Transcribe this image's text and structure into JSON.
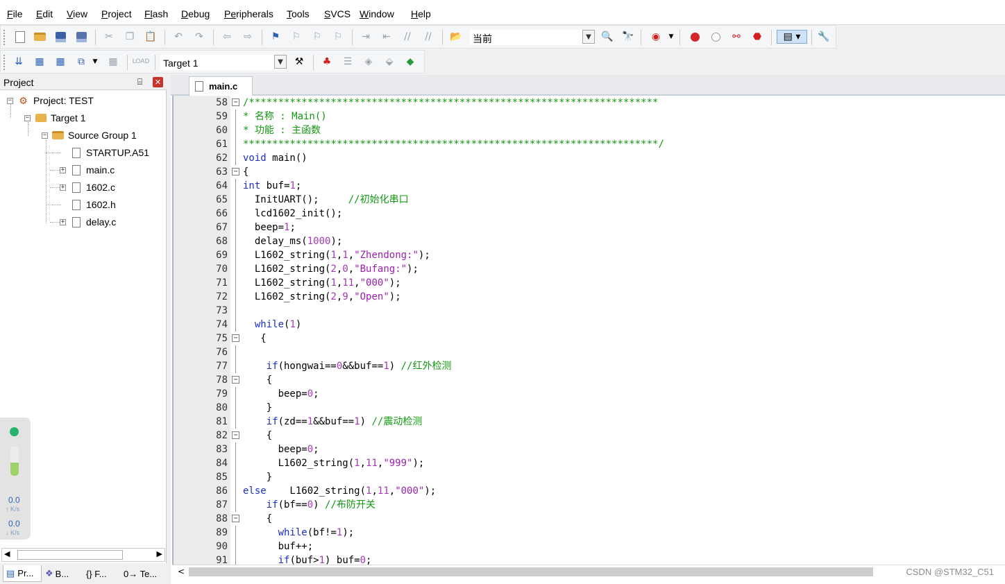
{
  "menubar": {
    "items": [
      {
        "key": "F",
        "rest": "ile"
      },
      {
        "key": "E",
        "rest": "dit"
      },
      {
        "key": "V",
        "rest": "iew"
      },
      {
        "key": "P",
        "rest": "roject"
      },
      {
        "key": "Fl",
        "rest": "ash",
        "pre": ""
      },
      {
        "key": "D",
        "rest": "ebug"
      },
      {
        "key": "Pe",
        "rest": "ripherals"
      },
      {
        "key": "T",
        "rest": "ools"
      },
      {
        "key": "S",
        "rest": "VCS"
      },
      {
        "key": "W",
        "rest": "indow"
      },
      {
        "key": "H",
        "rest": "elp"
      }
    ]
  },
  "toolbar1": {
    "find_combo_value": "当前"
  },
  "toolbar2": {
    "target_combo_value": "Target 1"
  },
  "project_panel": {
    "title": "Project",
    "pin_glyph": "⌸",
    "close_glyph": "✕",
    "tree": {
      "project": "Project: TEST",
      "target": "Target 1",
      "group": "Source Group 1",
      "files": [
        "STARTUP.A51",
        "main.c",
        "1602.c",
        "1602.h",
        "delay.c"
      ]
    },
    "speed": {
      "up_value": "0.0",
      "up_unit": "↑ K/s",
      "down_value": "0.0",
      "down_unit": "↓ K/s"
    },
    "bottom_tabs": [
      "Pr...",
      "B...",
      "{} F...",
      "0→ Te..."
    ]
  },
  "editor": {
    "active_tab": "main.c",
    "watermark": "CSDN @STM32_C51",
    "lines": [
      {
        "n": "58",
        "html": "<span class=\"cm\">/**********************************************************************</span>"
      },
      {
        "n": "59",
        "html": "<span class=\"cm\">* 名称 : Main()</span>"
      },
      {
        "n": "60",
        "html": "<span class=\"cm\">* 功能 : 主函数</span>"
      },
      {
        "n": "61",
        "html": "<span class=\"cm\">***********************************************************************/</span>"
      },
      {
        "n": "62",
        "html": "<span class=\"kw\">void</span> main()"
      },
      {
        "n": "63",
        "html": "{"
      },
      {
        "n": "64",
        "html": "<span class=\"kw\">int</span> buf=<span class=\"nm\">1</span>;"
      },
      {
        "n": "65",
        "html": "  InitUART();     <span class=\"cm\">//初始化串口</span>"
      },
      {
        "n": "66",
        "html": "  lcd1602_init();"
      },
      {
        "n": "67",
        "html": "  beep=<span class=\"nm\">1</span>;"
      },
      {
        "n": "68",
        "html": "  delay_ms(<span class=\"nm\">1000</span>);"
      },
      {
        "n": "69",
        "html": "  L1602_string(<span class=\"nm\">1</span>,<span class=\"nm\">1</span>,<span class=\"st\">\"Zhendong:\"</span>);"
      },
      {
        "n": "70",
        "html": "  L1602_string(<span class=\"nm\">2</span>,<span class=\"nm\">0</span>,<span class=\"st\">\"Bufang:\"</span>);"
      },
      {
        "n": "71",
        "html": "  L1602_string(<span class=\"nm\">1</span>,<span class=\"nm\">11</span>,<span class=\"st\">\"000\"</span>);"
      },
      {
        "n": "72",
        "html": "  L1602_string(<span class=\"nm\">2</span>,<span class=\"nm\">9</span>,<span class=\"st\">\"Open\"</span>);"
      },
      {
        "n": "73",
        "html": ""
      },
      {
        "n": "74",
        "html": "  <span class=\"kw\">while</span>(<span class=\"nm\">1</span>)"
      },
      {
        "n": "75",
        "html": "   {"
      },
      {
        "n": "76",
        "html": ""
      },
      {
        "n": "77",
        "html": "    <span class=\"kw\">if</span>(hongwai==<span class=\"nm\">0</span>&amp;&amp;buf==<span class=\"nm\">1</span>) <span class=\"cm\">//红外检测</span>"
      },
      {
        "n": "78",
        "html": "    {"
      },
      {
        "n": "79",
        "html": "      beep=<span class=\"nm\">0</span>;"
      },
      {
        "n": "80",
        "html": "    }"
      },
      {
        "n": "81",
        "html": "    <span class=\"kw\">if</span>(zd==<span class=\"nm\">1</span>&amp;&amp;buf==<span class=\"nm\">1</span>) <span class=\"cm\">//震动检测</span>"
      },
      {
        "n": "82",
        "html": "    {"
      },
      {
        "n": "83",
        "html": "      beep=<span class=\"nm\">0</span>;"
      },
      {
        "n": "84",
        "html": "      L1602_string(<span class=\"nm\">1</span>,<span class=\"nm\">11</span>,<span class=\"st\">\"999\"</span>);"
      },
      {
        "n": "85",
        "html": "    }"
      },
      {
        "n": "86",
        "html": "<span class=\"kw\">else</span>    L1602_string(<span class=\"nm\">1</span>,<span class=\"nm\">11</span>,<span class=\"st\">\"000\"</span>);"
      },
      {
        "n": "87",
        "html": "    <span class=\"kw\">if</span>(bf==<span class=\"nm\">0</span>) <span class=\"cm\">//布防开关</span>"
      },
      {
        "n": "88",
        "html": "    {"
      },
      {
        "n": "89",
        "html": "      <span class=\"kw\">while</span>(bf!=<span class=\"nm\">1</span>);"
      },
      {
        "n": "90",
        "html": "      buf++;"
      },
      {
        "n": "91",
        "html": "      <span class=\"kw\">if</span>(buf&gt;<span class=\"nm\">1</span>) buf=<span class=\"nm\">0</span>;"
      }
    ]
  }
}
